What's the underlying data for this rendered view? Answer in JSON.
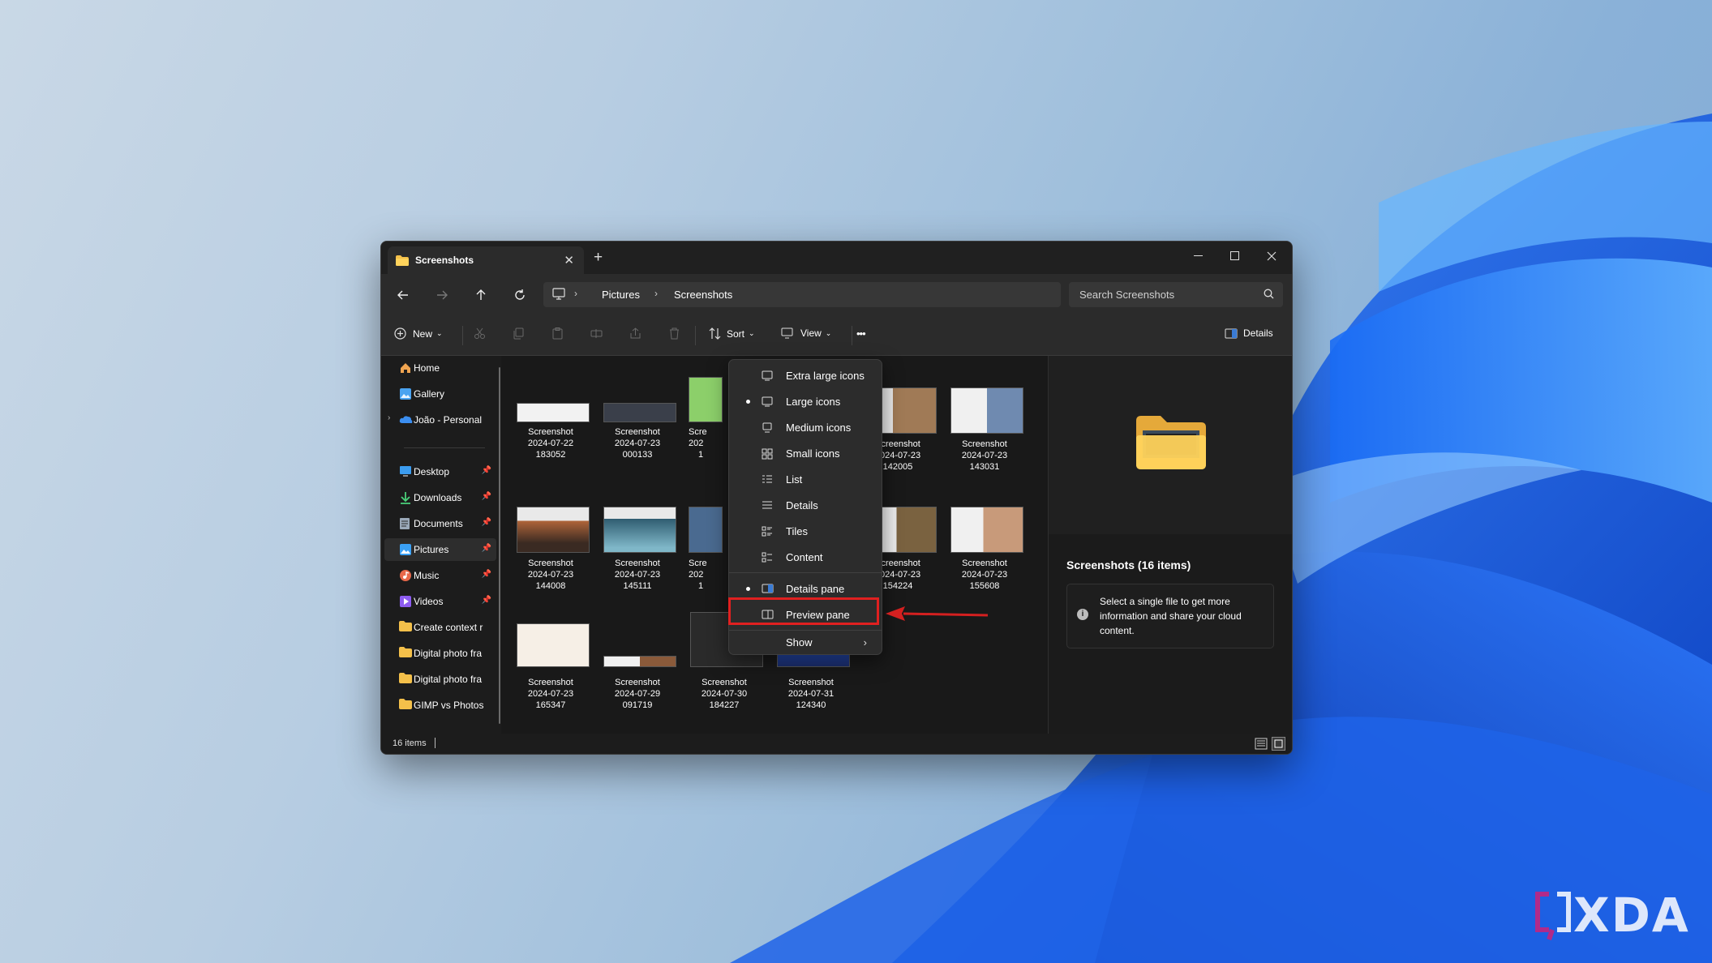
{
  "window": {
    "tab_title": "Screenshots",
    "new_tab": "+",
    "close_tab": "✕",
    "minimize": "—",
    "maximize": "☐",
    "close": "✕"
  },
  "navigation": {
    "breadcrumb": [
      "Pictures",
      "Screenshots"
    ],
    "search_placeholder": "Search Screenshots"
  },
  "toolbar": {
    "new_label": "New",
    "sort_label": "Sort",
    "view_label": "View",
    "more_label": "•••",
    "details_label": "Details"
  },
  "sidebar": {
    "items": [
      {
        "label": "Home",
        "icon": "home-icon"
      },
      {
        "label": "Gallery",
        "icon": "gallery-icon"
      },
      {
        "label": "João - Personal",
        "icon": "onedrive-icon"
      },
      {
        "label": "Desktop",
        "icon": "desktop-icon"
      },
      {
        "label": "Downloads",
        "icon": "download-icon"
      },
      {
        "label": "Documents",
        "icon": "documents-icon"
      },
      {
        "label": "Pictures",
        "icon": "pictures-icon"
      },
      {
        "label": "Music",
        "icon": "music-icon"
      },
      {
        "label": "Videos",
        "icon": "videos-icon"
      },
      {
        "label": "Create context r",
        "icon": "folder-icon"
      },
      {
        "label": "Digital photo fra",
        "icon": "folder-icon"
      },
      {
        "label": "Digital photo fra",
        "icon": "folder-icon"
      },
      {
        "label": "GIMP vs Photos",
        "icon": "folder-icon"
      }
    ]
  },
  "files": [
    {
      "name": "Screenshot",
      "date": "2024-07-22",
      "time": "183052"
    },
    {
      "name": "Screenshot",
      "date": "2024-07-23",
      "time": "000133"
    },
    {
      "name": "Scre",
      "date": "202",
      "time": "1"
    },
    {
      "name": "Screenshot",
      "date": "2024-07-23",
      "time": "142005"
    },
    {
      "name": "Screenshot",
      "date": "2024-07-23",
      "time": "143031"
    },
    {
      "name": "Screenshot",
      "date": "2024-07-23",
      "time": "144008"
    },
    {
      "name": "Screenshot",
      "date": "2024-07-23",
      "time": "145111"
    },
    {
      "name": "Scre",
      "date": "202",
      "time": "1"
    },
    {
      "name": "Screenshot",
      "date": "2024-07-23",
      "time": "154224"
    },
    {
      "name": "Screenshot",
      "date": "2024-07-23",
      "time": "155608"
    },
    {
      "name": "Screenshot",
      "date": "2024-07-23",
      "time": "165347"
    },
    {
      "name": "Screenshot",
      "date": "2024-07-29",
      "time": "091719"
    },
    {
      "name": "Screenshot",
      "date": "2024-07-30",
      "time": "184227"
    },
    {
      "name": "Screenshot",
      "date": "2024-07-31",
      "time": "124340"
    }
  ],
  "view_menu": {
    "items": [
      {
        "label": "Extra large icons",
        "selected": false
      },
      {
        "label": "Large icons",
        "selected": true
      },
      {
        "label": "Medium icons",
        "selected": false
      },
      {
        "label": "Small icons",
        "selected": false
      },
      {
        "label": "List",
        "selected": false
      },
      {
        "label": "Details",
        "selected": false
      },
      {
        "label": "Tiles",
        "selected": false
      },
      {
        "label": "Content",
        "selected": false
      },
      {
        "label": "Details pane",
        "selected": true
      },
      {
        "label": "Preview pane",
        "selected": false
      },
      {
        "label": "Show",
        "selected": false
      }
    ]
  },
  "details_pane": {
    "title": "Screenshots (16 items)",
    "info": "Select a single file to get more information and share your cloud content."
  },
  "status": {
    "item_count": "16 items"
  },
  "watermark": "XDA",
  "colors": {
    "highlight_box": "#e02020",
    "window_bg": "#191919",
    "menu_bg": "#2c2c2c"
  }
}
